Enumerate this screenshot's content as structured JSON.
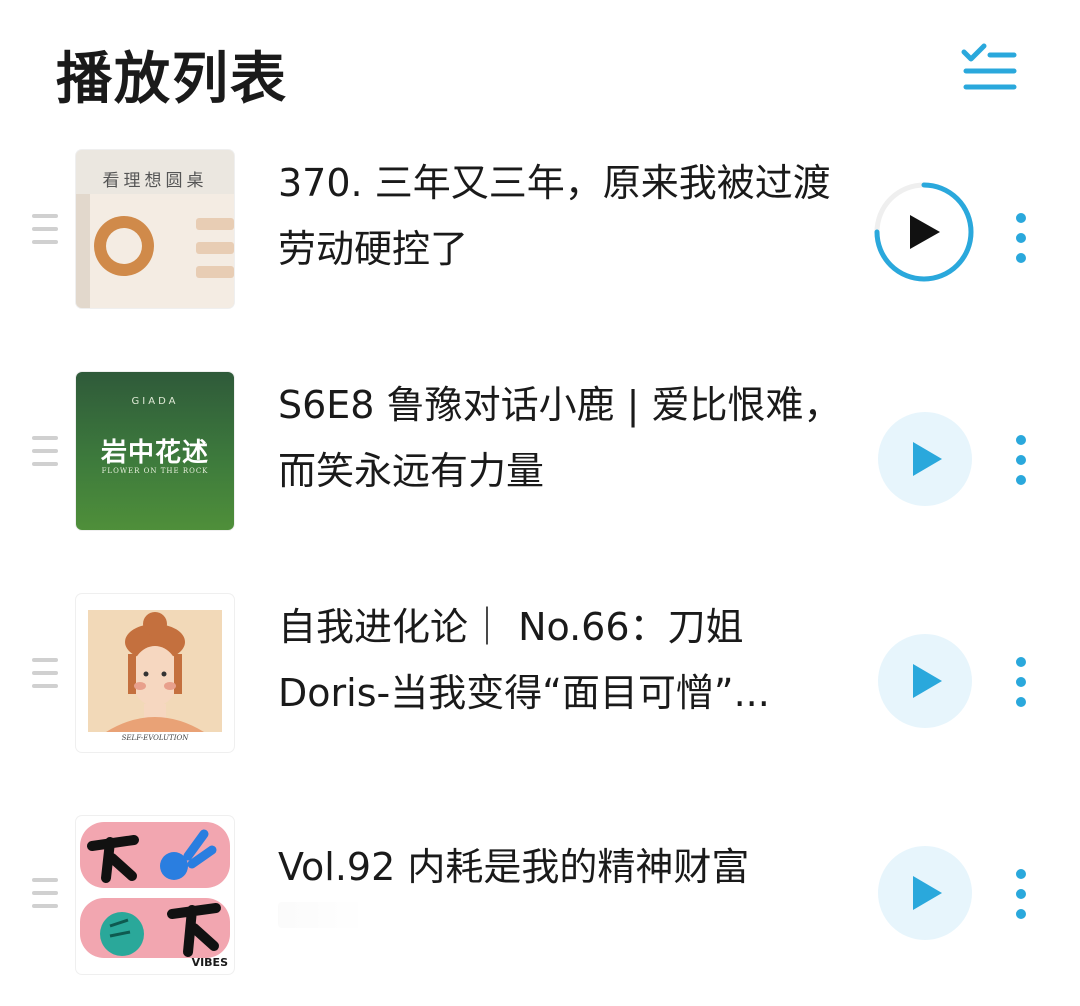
{
  "header": {
    "title": "播放列表",
    "queue_icon": "checklist-icon",
    "accent": "#2aa8dc"
  },
  "playlist": [
    {
      "title": "370. 三年又三年，原来我被过渡劳动硬控了",
      "cover_text": "看理想圆桌",
      "state": "playing",
      "progress": 0.75
    },
    {
      "title": "S6E8 鲁豫对话小鹿 | 爱比恨难，而笑永远有力量",
      "cover_brand": "GIADA",
      "cover_title": "岩中花述",
      "cover_subtitle": "FLOWER ON THE ROCK",
      "state": "queued"
    },
    {
      "title": "自我进化论｜ No.66：刀姐Doris-当我变得“面目可憎”...",
      "cover_caption": "SELF-EVOLUTION",
      "state": "queued"
    },
    {
      "title": "Vol.92 内耗是我的精神财富",
      "cover_caption": "VIBES",
      "state": "queued"
    }
  ],
  "colors": {
    "play_bg": "#e7f5fc",
    "play_icon": "#2aa8dc",
    "handle": "#d0d0d0"
  }
}
